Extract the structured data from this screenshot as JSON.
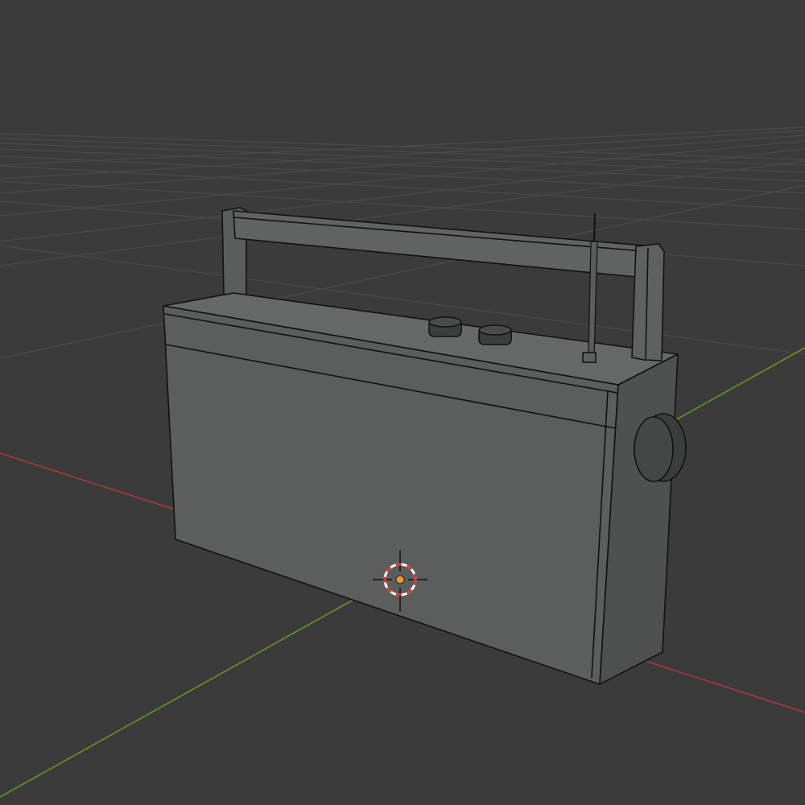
{
  "viewport": {
    "background": "#3b3b3b",
    "grid_color": "#4a4a4a",
    "x_axis_color": "#b0383f",
    "y_axis_color": "#6e9a22",
    "shading": "solid",
    "overlay": "wireframe-edges"
  },
  "object": {
    "body_front": "#5a5d5c",
    "body_side": "#515352",
    "body_top": "#636665",
    "edge_color": "#111111"
  },
  "cursor": {
    "icon": "3d-cursor-icon",
    "origin_color": "#e8993a"
  }
}
